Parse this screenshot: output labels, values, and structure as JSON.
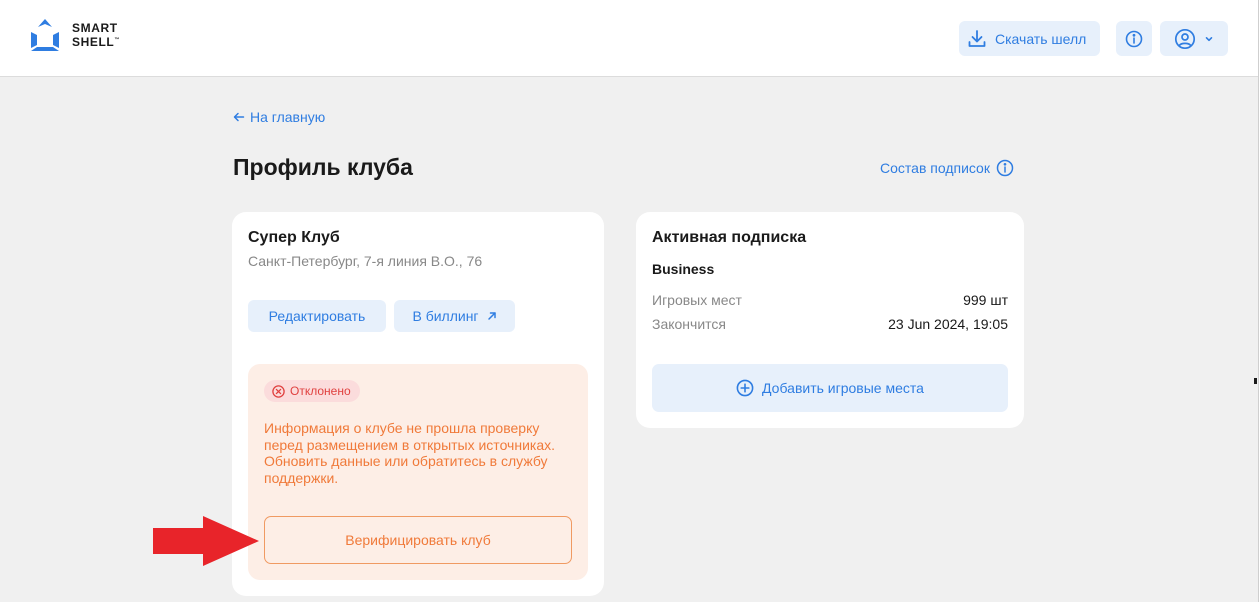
{
  "header": {
    "logo_line1": "SMART",
    "logo_line2": "SHELL",
    "logo_tm": "™",
    "download_label": "Скачать шелл",
    "icons": [
      "download-icon",
      "info-icon",
      "user-icon",
      "chevron-down-icon"
    ]
  },
  "nav": {
    "back_label": "На главную"
  },
  "page": {
    "title": "Профиль клуба",
    "subscriptions_link": "Состав подписок"
  },
  "club": {
    "name": "Супер Клуб",
    "address": "Санкт-Петербург, 7-я линия В.О., 76",
    "edit_label": "Редактировать",
    "billing_label": "В биллинг",
    "status_label": "Отклонено",
    "alert_text": "Информация о клубе не прошла проверку перед размещением в открытых источниках. Обновить данные или обратитесь в службу поддержки.",
    "verify_label": "Верифицировать клуб"
  },
  "subscription": {
    "title": "Активная подписка",
    "plan": "Business",
    "seats_label": "Игровых мест",
    "seats_value": "999 шт",
    "expires_label": "Закончится",
    "expires_value": "23 Jun 2024, 19:05",
    "add_seats_label": "Добавить игровые места"
  },
  "colors": {
    "accent": "#2f7de1",
    "accent_bg": "#e7f0fb",
    "warning_text": "#f07a3a",
    "warning_bg": "#fdeee6",
    "error_text": "#e0403f",
    "arrow": "#e8242a"
  }
}
